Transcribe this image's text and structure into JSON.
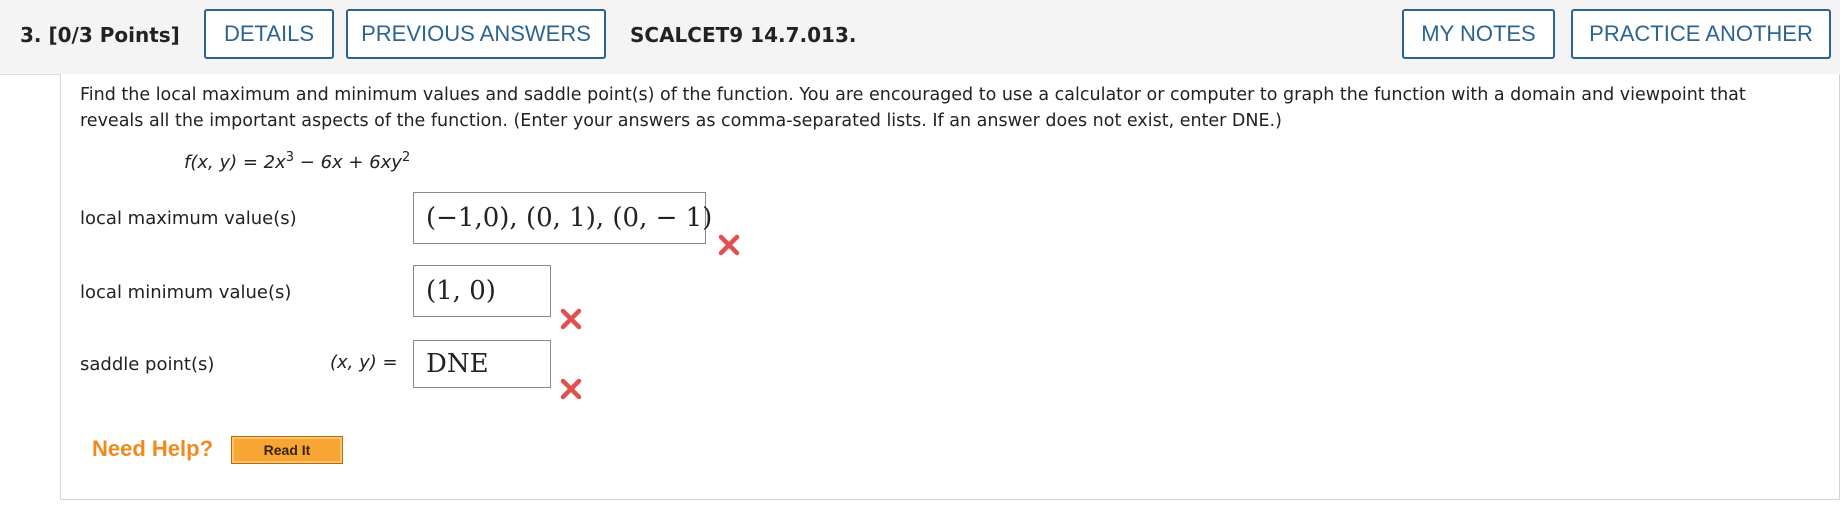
{
  "header": {
    "question_label": "3. [0/3 Points]",
    "details_label": "DETAILS",
    "previous_answers_label": "PREVIOUS ANSWERS",
    "question_code": "SCALCET9 14.7.013.",
    "my_notes_label": "MY NOTES",
    "practice_another_label": "PRACTICE ANOTHER"
  },
  "question": {
    "prompt": "Find the local maximum and minimum values and saddle point(s) of the function. You are encouraged to use a calculator or computer to graph the function with a domain and viewpoint that reveals all the important aspects of the function. (Enter your answers as comma-separated lists. If an answer does not exist, enter DNE.)",
    "formula_prefix": "f(x, y) = 2x",
    "exp1": "3",
    "formula_mid": " − 6x + 6xy",
    "exp2": "2"
  },
  "answers": [
    {
      "label": "local maximum value(s)",
      "value": "(−1,0), (0, 1), (0, − 1)",
      "status": "incorrect"
    },
    {
      "label": "local minimum value(s)",
      "value": "(1, 0)",
      "status": "incorrect"
    },
    {
      "label": "saddle point(s)",
      "prefix": "(x, y)  =",
      "value": "DNE",
      "status": "incorrect"
    }
  ],
  "help": {
    "need_help_label": "Need Help?",
    "read_it_label": "Read It"
  },
  "colors": {
    "accent_blue": "#2b6392",
    "incorrect_red": "#e05050",
    "help_orange": "#f08a1c"
  }
}
